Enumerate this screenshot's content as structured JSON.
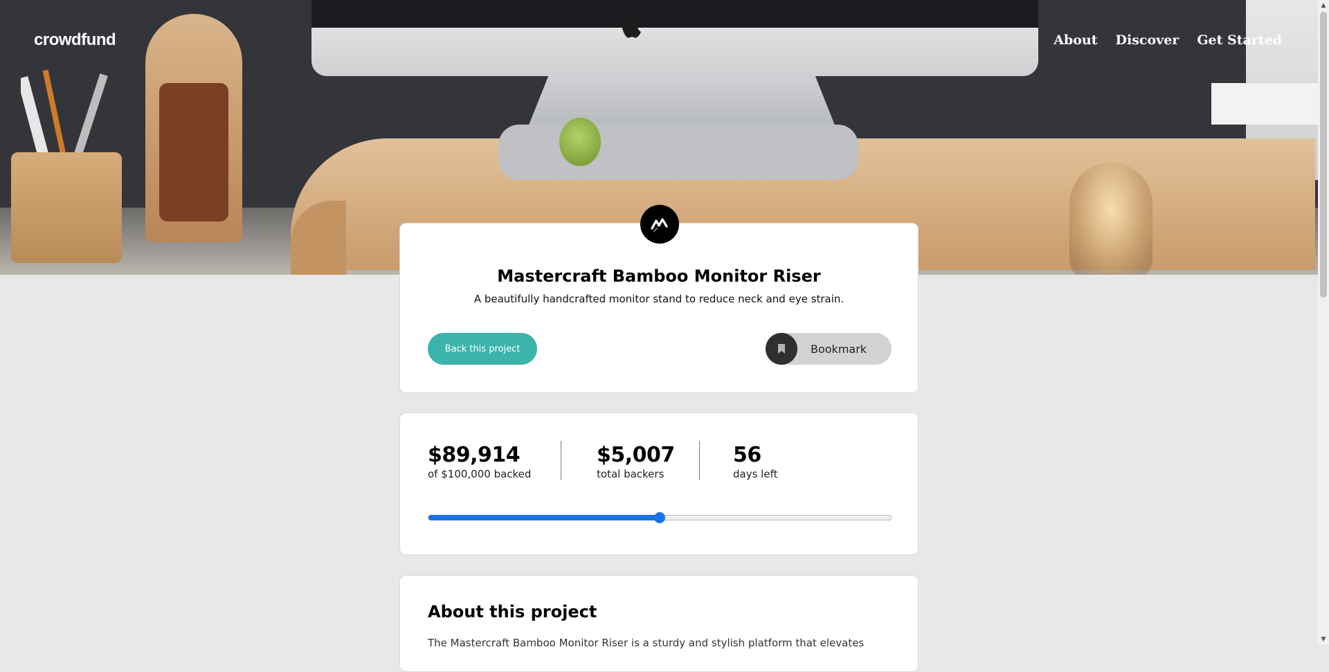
{
  "header": {
    "logo": "crowdfund",
    "nav": [
      "About",
      "Discover",
      "Get Started"
    ]
  },
  "hero": {
    "alt": ""
  },
  "project": {
    "title": "Mastercraft Bamboo Monitor Riser",
    "subtitle": "A beautifully handcrafted monitor stand to reduce neck and eye strain.",
    "back_label": "Back this project",
    "bookmark_label": "Bookmark"
  },
  "stats": {
    "backed_amount": "$89,914",
    "backed_label": "of $100,000 backed",
    "backers_count": "$5,007",
    "backers_label": "total backers",
    "days_left": "56",
    "days_label": "days left",
    "progress_fraction": 0.5
  },
  "about": {
    "title": "About this project",
    "text": "The Mastercraft Bamboo Monitor Riser is a sturdy and stylish platform that elevates"
  },
  "colors": {
    "accent": "#3cb4ac",
    "progress": "#1a73e8",
    "dark": "#2f2f2f"
  },
  "icons": {
    "brand": "mastercraft-logo-icon",
    "bookmark": "bookmark-icon"
  }
}
